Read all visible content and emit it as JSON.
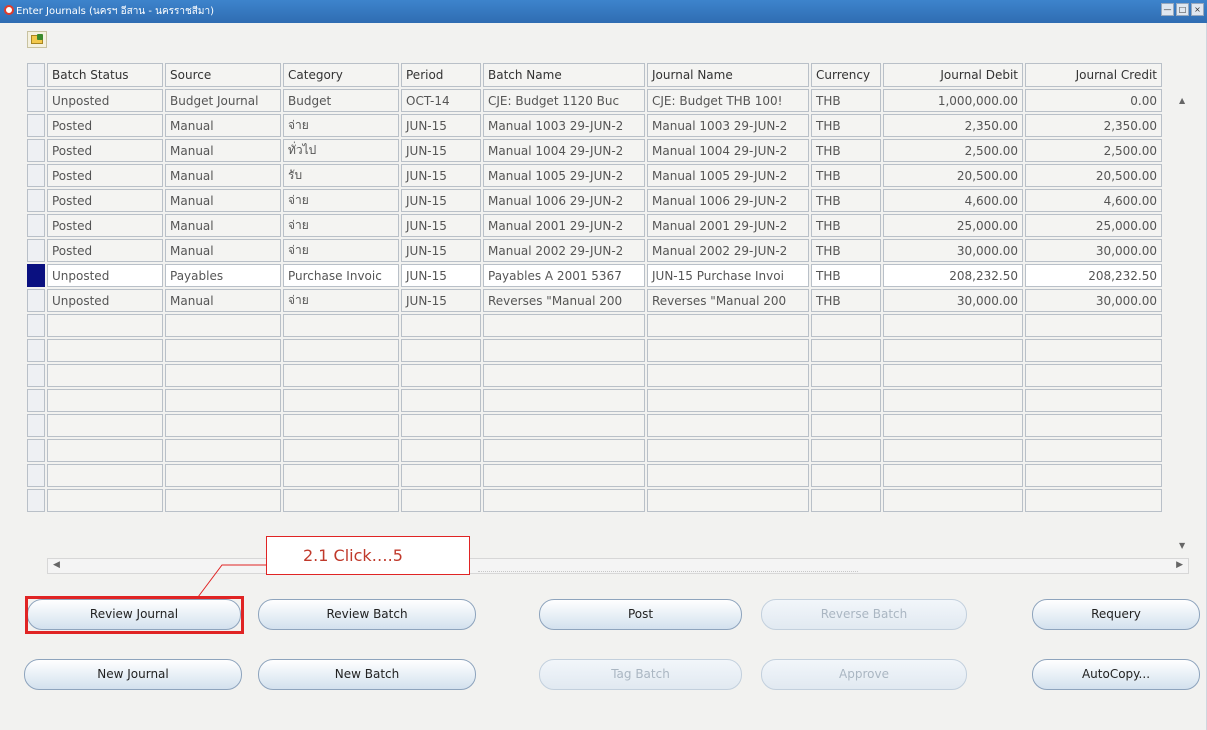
{
  "window": {
    "title": "Enter Journals (นครฯ อีสาน - นครราชสีมา)"
  },
  "columns": [
    {
      "key": "status",
      "label": "Batch Status"
    },
    {
      "key": "source",
      "label": "Source"
    },
    {
      "key": "category",
      "label": "Category"
    },
    {
      "key": "period",
      "label": "Period"
    },
    {
      "key": "batch",
      "label": "Batch Name"
    },
    {
      "key": "journal",
      "label": "Journal Name"
    },
    {
      "key": "currency",
      "label": "Currency"
    },
    {
      "key": "debit",
      "label": "Journal Debit"
    },
    {
      "key": "credit",
      "label": "Journal Credit"
    }
  ],
  "rows": [
    {
      "status": "Unposted",
      "source": "Budget Journal",
      "category": "Budget",
      "period": "OCT-14",
      "batch": "CJE: Budget 1120 Buc",
      "journal": "CJE: Budget THB 100!",
      "currency": "THB",
      "debit": "1,000,000.00",
      "credit": "0.00"
    },
    {
      "status": "Posted",
      "source": "Manual",
      "category": "จ่าย",
      "period": "JUN-15",
      "batch": "Manual 1003 29-JUN-2",
      "journal": "Manual 1003 29-JUN-2",
      "currency": "THB",
      "debit": "2,350.00",
      "credit": "2,350.00"
    },
    {
      "status": "Posted",
      "source": "Manual",
      "category": "ทั่วไป",
      "period": "JUN-15",
      "batch": "Manual 1004 29-JUN-2",
      "journal": "Manual 1004 29-JUN-2",
      "currency": "THB",
      "debit": "2,500.00",
      "credit": "2,500.00"
    },
    {
      "status": "Posted",
      "source": "Manual",
      "category": "รับ",
      "period": "JUN-15",
      "batch": "Manual 1005 29-JUN-2",
      "journal": "Manual 1005 29-JUN-2",
      "currency": "THB",
      "debit": "20,500.00",
      "credit": "20,500.00"
    },
    {
      "status": "Posted",
      "source": "Manual",
      "category": "จ่าย",
      "period": "JUN-15",
      "batch": "Manual 1006 29-JUN-2",
      "journal": "Manual 1006 29-JUN-2",
      "currency": "THB",
      "debit": "4,600.00",
      "credit": "4,600.00"
    },
    {
      "status": "Posted",
      "source": "Manual",
      "category": "จ่าย",
      "period": "JUN-15",
      "batch": "Manual 2001 29-JUN-2",
      "journal": "Manual 2001 29-JUN-2",
      "currency": "THB",
      "debit": "25,000.00",
      "credit": "25,000.00"
    },
    {
      "status": "Posted",
      "source": "Manual",
      "category": "จ่าย",
      "period": "JUN-15",
      "batch": "Manual 2002 29-JUN-2",
      "journal": "Manual 2002 29-JUN-2",
      "currency": "THB",
      "debit": "30,000.00",
      "credit": "30,000.00"
    },
    {
      "status": "Unposted",
      "source": "Payables",
      "category": "Purchase Invoic",
      "period": "JUN-15",
      "batch": "Payables A 2001 5367",
      "journal": "JUN-15 Purchase Invoi",
      "currency": "THB",
      "debit": "208,232.50",
      "credit": "208,232.50"
    },
    {
      "status": "Unposted",
      "source": "Manual",
      "category": "จ่าย",
      "period": "JUN-15",
      "batch": "Reverses \"Manual 200",
      "journal": "Reverses \"Manual 200",
      "currency": "THB",
      "debit": "30,000.00",
      "credit": "30,000.00"
    }
  ],
  "empty_rows": 8,
  "active_row": 7,
  "buttons": {
    "review_journal": "Review Journal",
    "review_batch": "Review Batch",
    "post": "Post",
    "reverse_batch": "Reverse Batch",
    "requery": "Requery",
    "new_journal": "New Journal",
    "new_batch": "New Batch",
    "tag_batch": "Tag Batch",
    "approve": "Approve",
    "autocopy": "AutoCopy..."
  },
  "annotation": {
    "callout": "2.1 Click….5"
  },
  "colors": {
    "titlebar": "#2f6db2",
    "highlight": "#e02424",
    "current_record": "#0a1080"
  }
}
